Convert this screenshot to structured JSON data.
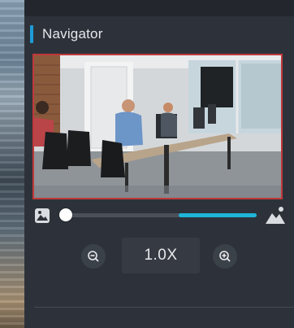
{
  "navigator": {
    "title": "Navigator",
    "zoom_value": "1.0X",
    "zoom_slider_fraction": 0.0,
    "icons": {
      "small": "small-image-icon",
      "large": "large-image-icon",
      "zoom_out": "zoom-out-icon",
      "zoom_in": "zoom-in-icon"
    },
    "colors": {
      "accent": "#1e9bd7",
      "preview_border": "#c0393b",
      "slider_fill": "#1fb4d8"
    }
  }
}
